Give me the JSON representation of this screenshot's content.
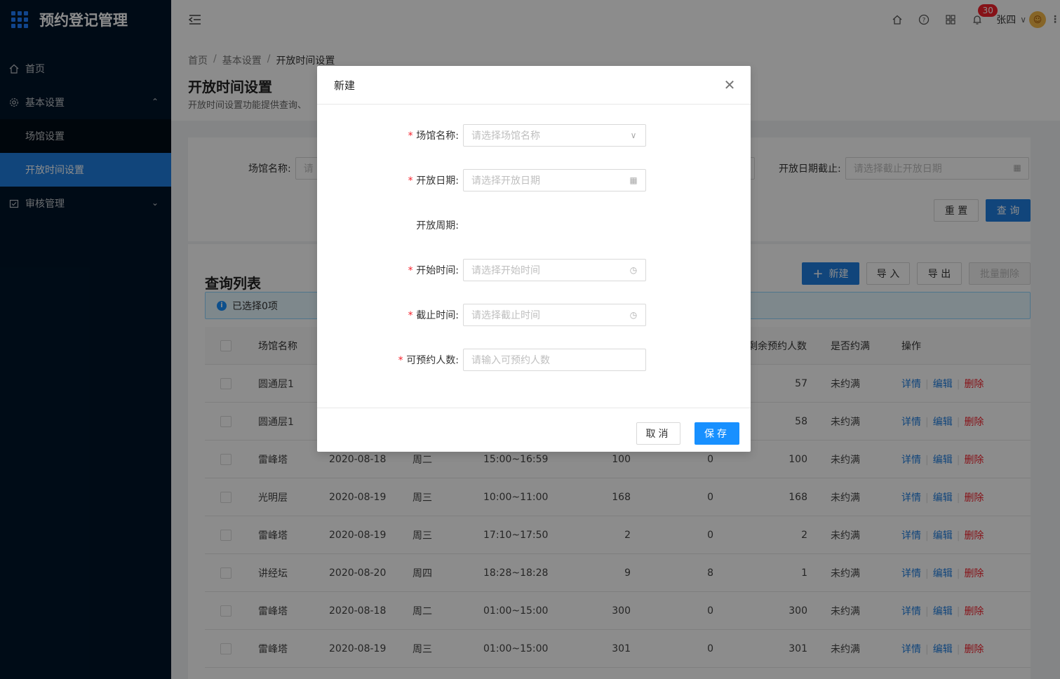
{
  "app": {
    "title": "预约登记管理"
  },
  "sidebar": {
    "items": [
      {
        "label": "首页",
        "icon": "home-icon"
      },
      {
        "label": "基本设置",
        "icon": "settings-icon",
        "expanded": true,
        "children": [
          {
            "label": "场馆设置"
          },
          {
            "label": "开放时间设置",
            "active": true
          }
        ]
      },
      {
        "label": "审核管理",
        "icon": "audit-icon"
      }
    ]
  },
  "header": {
    "notification_count": "30",
    "username": "张四"
  },
  "breadcrumb": [
    "首页",
    "基本设置",
    "开放时间设置"
  ],
  "page": {
    "title": "开放时间设置",
    "description": "开放时间设置功能提供查询、"
  },
  "search": {
    "venue_label": "场馆名称:",
    "venue_placeholder": "请",
    "end_date_label": "开放日期截止:",
    "end_date_placeholder": "请选择截止开放日期",
    "reset_label": "重 置",
    "query_label": "查 询"
  },
  "list": {
    "title": "查询列表",
    "selected_text": "已选择0项",
    "new_label": "新建",
    "import_label": "导 入",
    "export_label": "导 出",
    "batch_delete_label": "批量删除",
    "columns": {
      "venue": "场馆名称",
      "remaining": "剩余预约人数",
      "full": "是否约满",
      "actions": "操作"
    },
    "action_labels": {
      "detail": "详情",
      "edit": "编辑",
      "delete": "删除"
    },
    "rows": [
      {
        "venue": "圆通层1",
        "date": "",
        "week": "",
        "time": "",
        "total": "",
        "booked": "",
        "remaining": "57",
        "full": "未约满"
      },
      {
        "venue": "圆通层1",
        "date": "",
        "week": "",
        "time": "",
        "total": "",
        "booked": "",
        "remaining": "58",
        "full": "未约满"
      },
      {
        "venue": "雷峰塔",
        "date": "2020-08-18",
        "week": "周二",
        "time": "15:00~16:59",
        "total": "100",
        "booked": "0",
        "remaining": "100",
        "full": "未约满"
      },
      {
        "venue": "光明层",
        "date": "2020-08-19",
        "week": "周三",
        "time": "10:00~11:00",
        "total": "168",
        "booked": "0",
        "remaining": "168",
        "full": "未约满"
      },
      {
        "venue": "雷峰塔",
        "date": "2020-08-19",
        "week": "周三",
        "time": "17:10~17:50",
        "total": "2",
        "booked": "0",
        "remaining": "2",
        "full": "未约满"
      },
      {
        "venue": "讲经坛",
        "date": "2020-08-20",
        "week": "周四",
        "time": "18:28~18:28",
        "total": "9",
        "booked": "8",
        "remaining": "1",
        "full": "未约满"
      },
      {
        "venue": "雷峰塔",
        "date": "2020-08-18",
        "week": "周二",
        "time": "01:00~15:00",
        "total": "300",
        "booked": "0",
        "remaining": "300",
        "full": "未约满"
      },
      {
        "venue": "雷峰塔",
        "date": "2020-08-19",
        "week": "周三",
        "time": "01:00~15:00",
        "total": "301",
        "booked": "0",
        "remaining": "301",
        "full": "未约满"
      }
    ]
  },
  "modal": {
    "title": "新建",
    "fields": [
      {
        "label": "场馆名称:",
        "placeholder": "请选择场馆名称",
        "required": true,
        "suffix": "chevron-down-icon"
      },
      {
        "label": "开放日期:",
        "placeholder": "请选择开放日期",
        "required": true,
        "suffix": "calendar-icon"
      },
      {
        "label": "开放周期:",
        "placeholder": "",
        "required": false,
        "suffix": ""
      },
      {
        "label": "开始时间:",
        "placeholder": "请选择开始时间",
        "required": true,
        "suffix": "clock-icon"
      },
      {
        "label": "截止时间:",
        "placeholder": "请选择截止时间",
        "required": true,
        "suffix": "clock-icon"
      },
      {
        "label": "可预约人数:",
        "placeholder": "请输入可预约人数",
        "required": true,
        "suffix": ""
      }
    ],
    "cancel_label": "取消",
    "save_label": "保存"
  },
  "colors": {
    "primary": "#1f7fe0",
    "sidebar": "#001529",
    "danger": "#f5222d"
  }
}
